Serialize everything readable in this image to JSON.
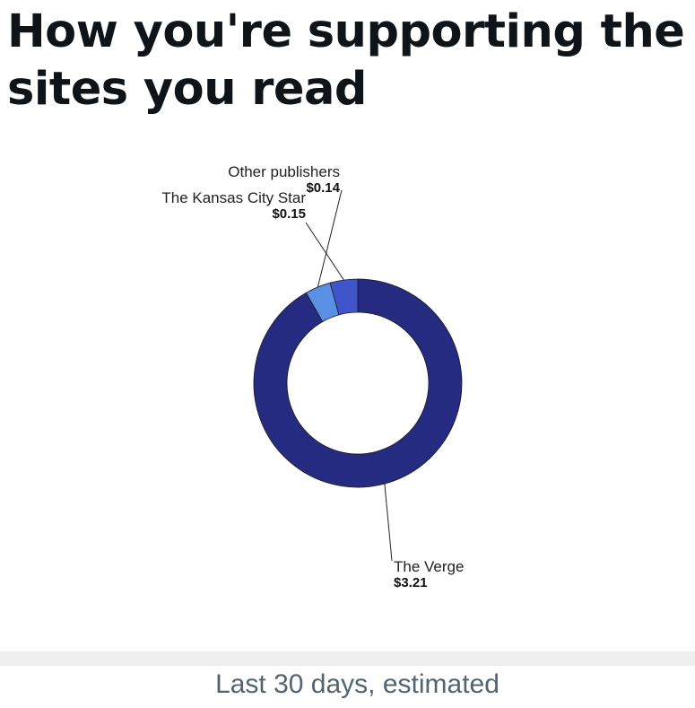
{
  "title": "How you're supporting the sites you read",
  "footer": {
    "caption": "Last 30 days, estimated"
  },
  "colors": {
    "background": "#ffffff",
    "title": "#0f1419",
    "caption": "#536471",
    "band": "#efefef"
  },
  "chart_data": {
    "type": "pie",
    "donut": true,
    "slices": [
      {
        "label": "The Verge",
        "value": 3.21,
        "value_label": "$3.21",
        "color": "#252b80"
      },
      {
        "label": "Other publishers",
        "value": 0.14,
        "value_label": "$0.14",
        "color": "#5a8fe6"
      },
      {
        "label": "The Kansas City Star",
        "value": 0.15,
        "value_label": "$0.15",
        "color": "#4055cc"
      }
    ],
    "legend": "none",
    "data_labels": "outside-with-leader-lines"
  }
}
